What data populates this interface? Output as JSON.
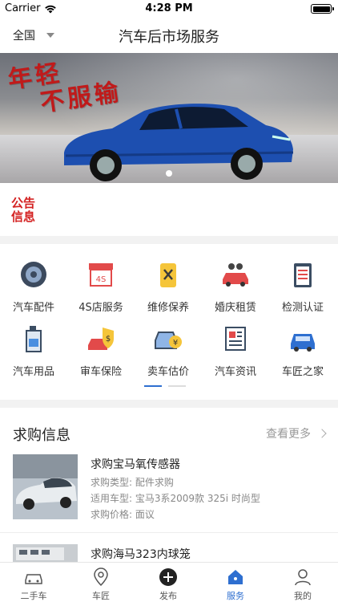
{
  "status_bar": {
    "carrier": "Carrier",
    "time": "4:28 PM"
  },
  "nav": {
    "location": "全国",
    "title": "汽车后市场服务"
  },
  "banner": {
    "slogan_line1": "年轻",
    "slogan_line2": "不服输"
  },
  "notice": {
    "line1": "公告",
    "line2": "信息"
  },
  "services": [
    {
      "label": "汽车配件",
      "icon": "tire-icon"
    },
    {
      "label": "4S店服务",
      "icon": "store-4s-icon"
    },
    {
      "label": "维修保养",
      "icon": "repair-tools-icon"
    },
    {
      "label": "婚庆租赁",
      "icon": "wedding-car-icon"
    },
    {
      "label": "检测认证",
      "icon": "checklist-icon"
    },
    {
      "label": "汽车用品",
      "icon": "oil-bottle-icon"
    },
    {
      "label": "审车保险",
      "icon": "insurance-car-icon"
    },
    {
      "label": "卖车估价",
      "icon": "car-price-icon"
    },
    {
      "label": "汽车资讯",
      "icon": "news-icon"
    },
    {
      "label": "车匠之家",
      "icon": "car-icon"
    }
  ],
  "purchase": {
    "title": "求购信息",
    "more": "查看更多",
    "items": [
      {
        "title": "求购宝马氧传感器",
        "type": "求购类型: 配件求购",
        "model": "适用车型: 宝马3系2009款 325i 时尚型",
        "price": "求购价格: 面议"
      },
      {
        "title": "求购海马323内球笼"
      }
    ]
  },
  "tabbar": [
    {
      "label": "二手车",
      "icon": "used-car-icon"
    },
    {
      "label": "车匠",
      "icon": "location-pin-icon"
    },
    {
      "label": "发布",
      "icon": "plus-circle-icon"
    },
    {
      "label": "服务",
      "icon": "home-icon",
      "active": true
    },
    {
      "label": "我的",
      "icon": "person-icon"
    }
  ],
  "colors": {
    "accent": "#2e6fd0",
    "notice": "#d42323"
  }
}
